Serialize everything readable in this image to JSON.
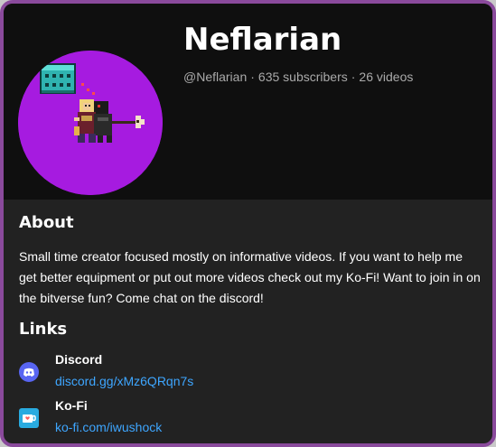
{
  "channel": {
    "name": "Neflarian",
    "handle": "@Neflarian",
    "subscribers": "635 subscribers",
    "videos": "26 videos",
    "separator": "·",
    "avatar_bg": "#a61be0"
  },
  "about": {
    "title": "About",
    "description": "Small time creator focused mostly on informative videos. If you want to help me get better equipment or put out more videos check out my Ko-Fi! Want to join in on the bitverse fun? Come chat on the discord!"
  },
  "links": {
    "title": "Links",
    "items": [
      {
        "name": "Discord",
        "url": "discord.gg/xMz6QRqn7s",
        "icon": "discord-icon",
        "color": "#5865f2"
      },
      {
        "name": "Ko-Fi",
        "url": "ko-fi.com/iwushock",
        "icon": "kofi-cup-icon",
        "color": "#29abe0"
      }
    ]
  },
  "colors": {
    "frame_border": "#8a4a9c",
    "link": "#3ea6ff",
    "header_bg": "#0f0f0f",
    "panel_bg": "#222222"
  }
}
